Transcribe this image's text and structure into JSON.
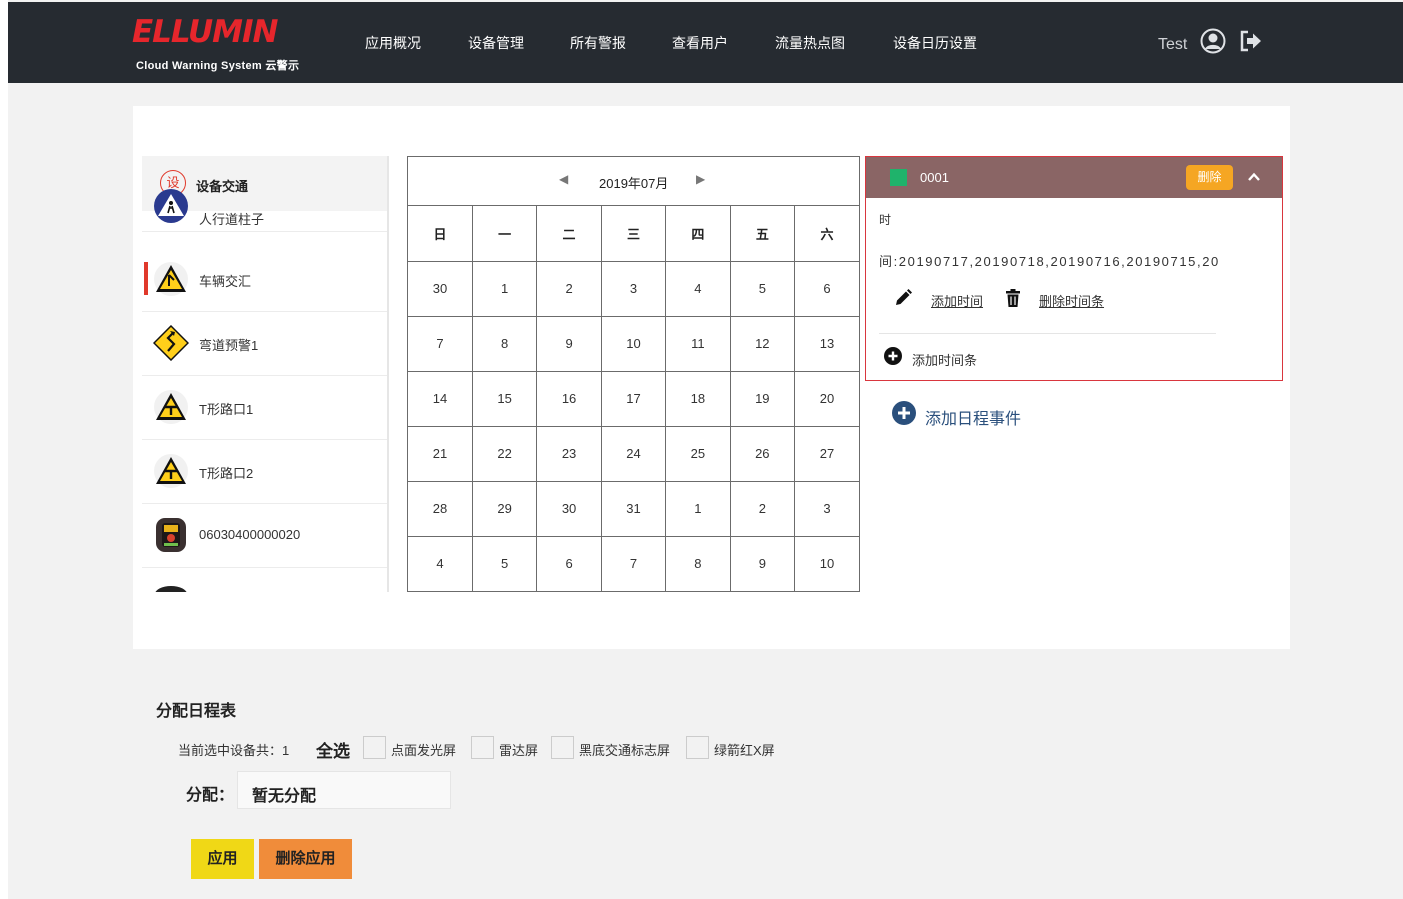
{
  "brand": {
    "logo_text": "ELLUMIN",
    "tagline": "Cloud Warning System 云警示"
  },
  "nav": [
    "应用概况",
    "设备管理",
    "所有警报",
    "查看用户",
    "流量热点图",
    "设备日历设置"
  ],
  "user": {
    "name": "Test",
    "avatar_icon": "user-circle-icon",
    "logout_icon": "logout-icon"
  },
  "device_panel": {
    "badge": "设",
    "title": "设备交通",
    "devices": [
      {
        "label": "人行道柱子",
        "icon": "pedestrian-sign-icon"
      },
      {
        "label": "车辆交汇",
        "icon": "warning-triangle-icon",
        "selected": true
      },
      {
        "label": "弯道预警1",
        "icon": "curve-warning-icon"
      },
      {
        "label": "T形路口1",
        "icon": "t-junction-icon"
      },
      {
        "label": "T形路口2",
        "icon": "t-junction-icon"
      },
      {
        "label": "06030400000020",
        "icon": "led-board-icon"
      }
    ]
  },
  "calendar": {
    "month_label": "2019年07月",
    "prev_icon": "caret-left-icon",
    "next_icon": "caret-right-icon",
    "weekdays": [
      "日",
      "一",
      "二",
      "三",
      "四",
      "五",
      "六"
    ],
    "weeks": [
      [
        {
          "d": "30",
          "other": true
        },
        {
          "d": "1"
        },
        {
          "d": "2"
        },
        {
          "d": "3"
        },
        {
          "d": "4"
        },
        {
          "d": "5"
        },
        {
          "d": "6"
        }
      ],
      [
        {
          "d": "7"
        },
        {
          "d": "8"
        },
        {
          "d": "9"
        },
        {
          "d": "10"
        },
        {
          "d": "11"
        },
        {
          "d": "12"
        },
        {
          "d": "13"
        }
      ],
      [
        {
          "d": "14"
        },
        {
          "d": "15"
        },
        {
          "d": "16",
          "today": true
        },
        {
          "d": "17"
        },
        {
          "d": "18"
        },
        {
          "d": "19"
        },
        {
          "d": "20"
        }
      ],
      [
        {
          "d": "21"
        },
        {
          "d": "22"
        },
        {
          "d": "23"
        },
        {
          "d": "24"
        },
        {
          "d": "25"
        },
        {
          "d": "26"
        },
        {
          "d": "27"
        }
      ],
      [
        {
          "d": "28"
        },
        {
          "d": "29"
        },
        {
          "d": "30"
        },
        {
          "d": "31"
        },
        {
          "d": "1",
          "other": true
        },
        {
          "d": "2",
          "other": true
        },
        {
          "d": "3",
          "other": true
        }
      ],
      [
        {
          "d": "4",
          "other": true
        },
        {
          "d": "5",
          "other": true
        },
        {
          "d": "6",
          "other": true
        },
        {
          "d": "7",
          "other": true
        },
        {
          "d": "8",
          "other": true
        },
        {
          "d": "9",
          "other": true
        },
        {
          "d": "10",
          "other": true
        }
      ]
    ]
  },
  "event": {
    "name": "0001",
    "color": "#1fb36b",
    "delete_label": "删除",
    "line1": "时",
    "line2": "间:20190717,20190718,20190716,20190715,20",
    "add_time": "添加时间",
    "delete_time_bar": "删除时间条",
    "add_time_bar": "添加时间条"
  },
  "add_schedule_event": "添加日程事件",
  "assign": {
    "section_title": "分配日程表",
    "selected_count": "当前选中设备共：1",
    "select_all": "全选",
    "options": [
      "点面发光屏",
      "雷达屏",
      "黑底交通标志屏",
      "绿箭红X屏"
    ],
    "assign_label": "分配：",
    "assign_value": "暂无分配",
    "apply": "应用",
    "remove_apply": "删除应用"
  },
  "colors": {
    "header_bg": "#262b31",
    "accent_red": "#e0392b",
    "event_header": "#8a6565",
    "delete_btn": "#f5a623",
    "apply_btn": "#f0d816",
    "remove_btn": "#f08c3a"
  }
}
